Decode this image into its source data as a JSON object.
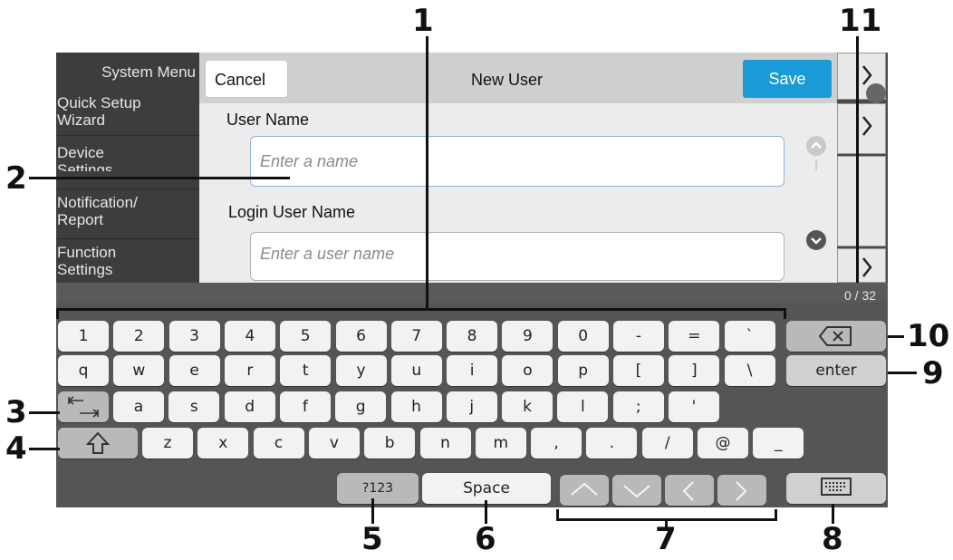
{
  "callouts": {
    "n1": "1",
    "n2": "2",
    "n3": "3",
    "n4": "4",
    "n5": "5",
    "n6": "6",
    "n7": "7",
    "n8": "8",
    "n9": "9",
    "n10": "10",
    "n11": "11"
  },
  "sidebar": {
    "title": "System Menu",
    "items": [
      {
        "line1": "Quick Setup",
        "line2": "Wizard"
      },
      {
        "line1": "Device",
        "line2": "Settings"
      },
      {
        "line1": "Notification/",
        "line2": "Report"
      },
      {
        "line1": "Function",
        "line2": "Settings"
      }
    ]
  },
  "dialog": {
    "cancel_label": "Cancel",
    "title": "New User",
    "save_label": "Save",
    "user_name_label": "User Name",
    "user_name_placeholder": "Enter a name",
    "login_user_name_label": "Login User Name",
    "login_user_name_placeholder": "Enter a user name",
    "char_counter": "0 / 32"
  },
  "keyboard": {
    "row1": [
      "1",
      "2",
      "3",
      "4",
      "5",
      "6",
      "7",
      "8",
      "9",
      "0",
      "-",
      "=",
      "`"
    ],
    "row2": [
      "q",
      "w",
      "e",
      "r",
      "t",
      "y",
      "u",
      "i",
      "o",
      "p",
      "[",
      "]",
      "\\"
    ],
    "row3": [
      "a",
      "s",
      "d",
      "f",
      "g",
      "h",
      "j",
      "k",
      "l",
      ";",
      "'"
    ],
    "row4": [
      "z",
      "x",
      "c",
      "v",
      "b",
      "n",
      "m",
      ",",
      ".",
      "/",
      "@",
      "_"
    ],
    "enter_label": "enter",
    "symbols_label": "?123",
    "space_label": "Space",
    "backspace_icon": "backspace-icon",
    "tab_icon": "tab-icon",
    "shift_icon": "shift-icon",
    "hide_keyboard_icon": "keyboard-icon",
    "cursor_icons": [
      "up-arrow-icon",
      "down-arrow-icon",
      "left-arrow-icon",
      "right-arrow-icon"
    ]
  }
}
